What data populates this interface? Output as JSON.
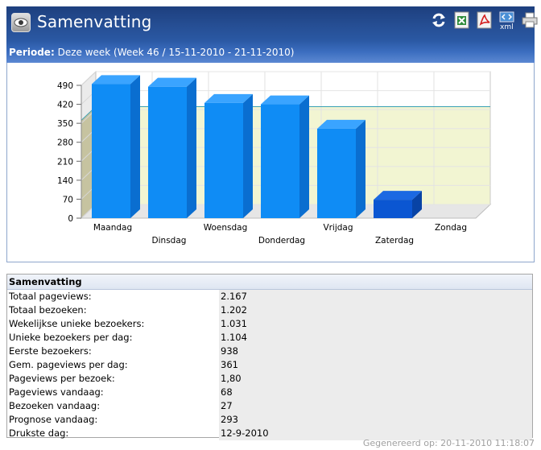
{
  "header": {
    "title": "Samenvatting",
    "toolbar": [
      {
        "icon": "refresh-icon",
        "label": "Vernieuwen"
      },
      {
        "icon": "excel-export-icon",
        "label": "Excel"
      },
      {
        "icon": "pdf-export-icon",
        "label": "PDF"
      },
      {
        "icon": "xml-export-icon",
        "label": "xml"
      },
      {
        "icon": "print-icon",
        "label": "Afdrukken"
      }
    ]
  },
  "period": {
    "label": "Periode:",
    "value": "Deze week (Week 46 / 15-11-2010 - 21-11-2010)"
  },
  "colors": {
    "bar_face": "#0f8cf5",
    "bar_today": "#0b56d2",
    "header_bg": "#264f95",
    "plot_bg": "#f2f5d2",
    "average_line": "#3aa0b4"
  },
  "chart_data": {
    "type": "bar",
    "categories": [
      "Maandag",
      "Dinsdag",
      "Woensdag",
      "Donderdag",
      "Vrijdag",
      "Zaterdag",
      "Zondag"
    ],
    "values": [
      495,
      485,
      425,
      420,
      330,
      68,
      0
    ],
    "average": 361,
    "ylim": [
      0,
      490
    ],
    "yticks": [
      "0",
      "70",
      "140",
      "210",
      "280",
      "350",
      "420",
      "490"
    ],
    "grid": true,
    "legend": "none",
    "title": "",
    "xlabel": "",
    "ylabel": ""
  },
  "summary": {
    "heading": "Samenvatting",
    "rows": [
      {
        "label": "Totaal pageviews:",
        "value": "2.167"
      },
      {
        "label": "Totaal bezoeken:",
        "value": "1.202"
      },
      {
        "label": "Wekelijkse unieke bezoekers:",
        "value": "1.031"
      },
      {
        "label": "Unieke bezoekers per dag:",
        "value": "1.104"
      },
      {
        "label": "Eerste bezoekers:",
        "value": "938"
      },
      {
        "label": "Gem. pageviews per dag:",
        "value": "361"
      },
      {
        "label": "Pageviews per bezoek:",
        "value": "1,80"
      },
      {
        "label": "Pageviews vandaag:",
        "value": "68"
      },
      {
        "label": "Bezoeken vandaag:",
        "value": "27"
      },
      {
        "label": "Prognose vandaag:",
        "value": "293"
      },
      {
        "label": "Drukste dag:",
        "value": "12-9-2010"
      }
    ]
  },
  "footer": {
    "generated": "Gegenereerd op:  20-11-2010 11:18:07"
  }
}
